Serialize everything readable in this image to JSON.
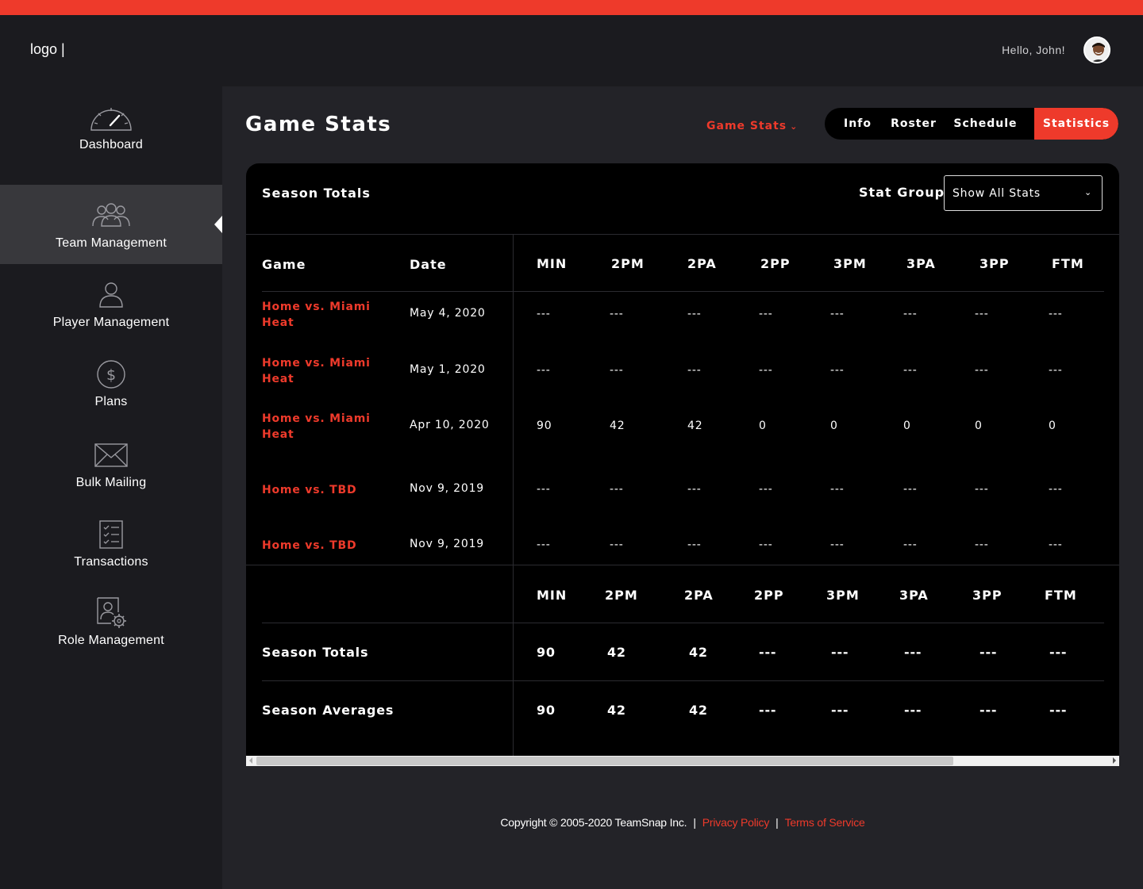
{
  "header": {
    "logo": "logo |",
    "greeting": "Hello, John!"
  },
  "colors": {
    "accent": "#ee3a2b",
    "background": "#1b1b1f",
    "card": "#000000"
  },
  "sidebar": {
    "items": [
      {
        "label": "Dashboard",
        "icon": "speedometer-icon",
        "active": false
      },
      {
        "label": "Team Management",
        "icon": "team-icon",
        "active": true
      },
      {
        "label": "Player Management",
        "icon": "user-icon",
        "active": false
      },
      {
        "label": "Plans",
        "icon": "dollar-icon",
        "active": false
      },
      {
        "label": "Bulk Mailing",
        "icon": "envelope-icon",
        "active": false
      },
      {
        "label": "Transactions",
        "icon": "checklist-icon",
        "active": false
      },
      {
        "label": "Role Management",
        "icon": "user-gear-icon",
        "active": false
      }
    ]
  },
  "page": {
    "title": "Game Stats",
    "dropdown_label": "Game Stats",
    "tabs": [
      {
        "label": "Info",
        "active": false
      },
      {
        "label": "Roster",
        "active": false
      },
      {
        "label": "Schedule",
        "active": false
      },
      {
        "label": "Statistics",
        "active": true
      }
    ]
  },
  "card": {
    "title": "Season Totals",
    "stat_group_label": "Stat Group",
    "stat_group_value": "Show All Stats"
  },
  "table": {
    "game_header": "Game",
    "date_header": "Date",
    "stat_headers": [
      "MIN",
      "2PM",
      "2PA",
      "2PP",
      "3PM",
      "3PA",
      "3PP",
      "FTM"
    ],
    "rows": [
      {
        "game": "Home vs. Miami Heat",
        "date": "May 4, 2020",
        "stats": [
          "---",
          "---",
          "---",
          "---",
          "---",
          "---",
          "---",
          "---"
        ]
      },
      {
        "game": "Home vs. Miami Heat",
        "date": "May 1, 2020",
        "stats": [
          "---",
          "---",
          "---",
          "---",
          "---",
          "---",
          "---",
          "---"
        ]
      },
      {
        "game": "Home vs. Miami Heat",
        "date": "Apr 10, 2020",
        "stats": [
          "90",
          "42",
          "42",
          "0",
          "0",
          "0",
          "0",
          "0"
        ]
      },
      {
        "game": "Home vs. TBD",
        "date": "Nov 9, 2019",
        "stats": [
          "---",
          "---",
          "---",
          "---",
          "---",
          "---",
          "---",
          "---"
        ]
      },
      {
        "game": "Home vs. TBD",
        "date": "Nov 9, 2019",
        "stats": [
          "---",
          "---",
          "---",
          "---",
          "---",
          "---",
          "---",
          "---"
        ]
      }
    ]
  },
  "summary": {
    "stat_headers": [
      "MIN",
      "2PM",
      "2PA",
      "2PP",
      "3PM",
      "3PA",
      "3PP",
      "FTM"
    ],
    "rows": [
      {
        "label": "Season Totals",
        "stats": [
          "90",
          "42",
          "42",
          "---",
          "---",
          "---",
          "---",
          "---"
        ]
      },
      {
        "label": "Season Averages",
        "stats": [
          "90",
          "42",
          "42",
          "---",
          "---",
          "---",
          "---",
          "---"
        ]
      }
    ]
  },
  "footer": {
    "copyright": "Copyright © 2005-2020 TeamSnap Inc.",
    "privacy": "Privacy Policy",
    "terms": "Terms of Service"
  }
}
